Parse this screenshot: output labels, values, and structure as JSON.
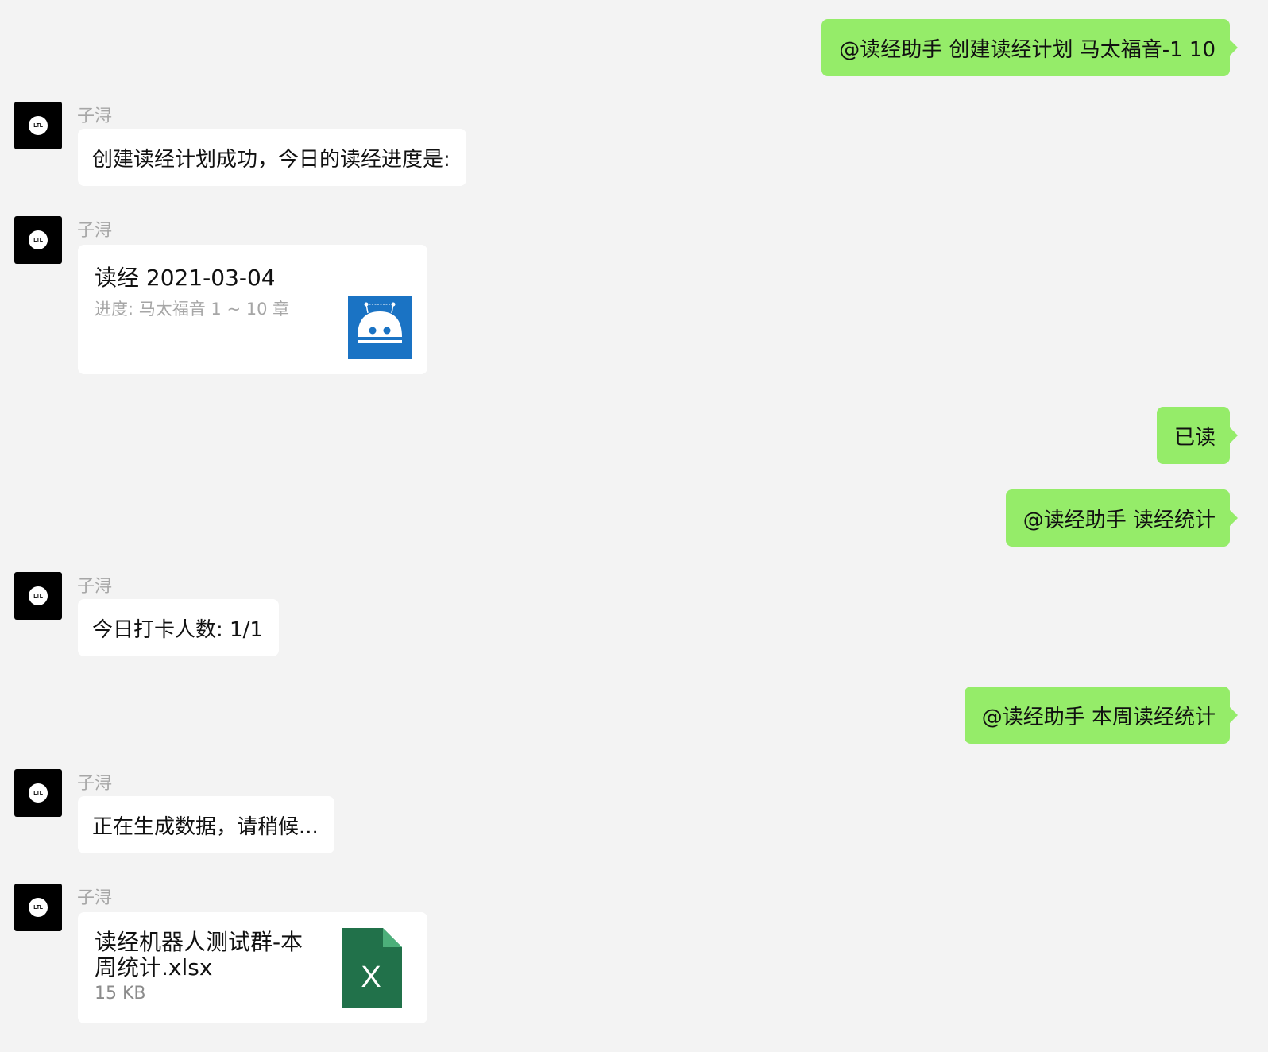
{
  "sender_name": "子浔",
  "avatar_text": "LTL",
  "outgoing": {
    "m1": "@读经助手  创建读经计划 马太福音-1 10",
    "m2": "已读",
    "m3": "@读经助手 读经统计",
    "m4": "@读经助手 本周读经统计"
  },
  "incoming": {
    "m1": "创建读经计划成功，今日的读经进度是:",
    "m2": "今日打卡人数: 1/1",
    "m3": "正在生成数据，请稍候..."
  },
  "link_card": {
    "title": "读经 2021-03-04",
    "description": "进度: 马太福音 1 ~ 10 章",
    "thumbnail_icon": "robot-icon",
    "thumbnail_color": "#1a73c4"
  },
  "file_card": {
    "name": "读经机器人测试群-本周统计.xlsx",
    "size": "15 KB",
    "icon": "excel-file-icon",
    "icon_letter": "X",
    "icon_color": "#21714a"
  },
  "colors": {
    "background": "#f3f3f3",
    "outgoing_bubble": "#95ec69",
    "incoming_bubble": "#ffffff",
    "sender_name": "#a6a6a6"
  }
}
